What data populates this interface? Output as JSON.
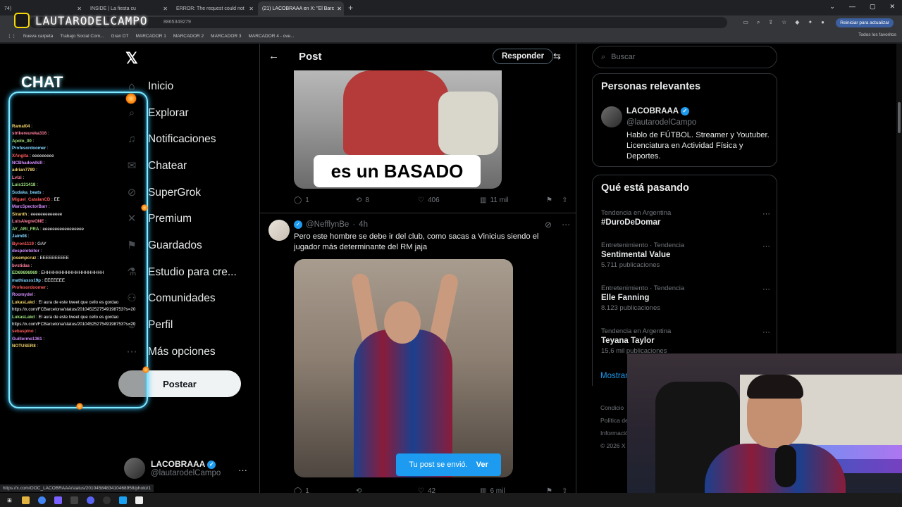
{
  "browser": {
    "tabs": [
      {
        "label": "74) ",
        "active": false
      },
      {
        "label": "INSIDE | La fiesta cu",
        "active": false
      },
      {
        "label": "ERROR: The request could not",
        "active": false
      },
      {
        "label": "(21) LACOBRAAA en X: \"El Barc",
        "active": true
      }
    ],
    "new_tab": "+",
    "url_fragment": "8865349279",
    "update_button": "Reiniciar para actualizar",
    "bookmarks": [
      "Nueva carpeta",
      "Trabajo Social Com...",
      "Gran DT",
      "MARCADOR 1",
      "MARCADOR 2",
      "MARCADOR 3",
      "MARCADOR 4 - ove..."
    ],
    "all_bookmarks": "Todos los favoritos",
    "status_url": "https://x.com/OOC_LACOBRAAA/status/2010458483410468958/photo/1"
  },
  "overlay": {
    "logo_text": "LAUTARODELCAMPO",
    "chat_title": "CHAT",
    "chat_lines": [
      {
        "user": "Ramal04",
        "msg": ""
      },
      {
        "user": "strikereureka316",
        "msg": ""
      },
      {
        "user": "Apolo_00",
        "msg": ""
      },
      {
        "user": "Profesordoomer",
        "msg": ""
      },
      {
        "user": "XAngita",
        "msg": "eeeeeeeee"
      },
      {
        "user": "NCBhadowlkill",
        "msg": ""
      },
      {
        "user": "adrian7789",
        "msg": ""
      },
      {
        "user": "Lvlzi",
        "msg": ""
      },
      {
        "user": "Luis131418",
        "msg": ""
      },
      {
        "user": "Sudaka_beats",
        "msg": ""
      },
      {
        "user": "Miguel_CatalanCD",
        "msg": "EE"
      },
      {
        "user": "MarcSpectorBarr",
        "msg": ""
      },
      {
        "user": "Siranth",
        "msg": "eeeeeeeeeeeee"
      },
      {
        "user": "LuisAlegreONE",
        "msg": ""
      },
      {
        "user": "AY_ARI_FRA",
        "msg": "eeeeeeeeeeeeeeeee"
      },
      {
        "user": "Jaim08",
        "msg": ""
      },
      {
        "user": "Byron1119",
        "msg": "GAY"
      },
      {
        "user": "despeloteitor",
        "msg": ""
      },
      {
        "user": "josempcruz",
        "msg": "EEEEEEEEEE"
      },
      {
        "user": "bvstidas",
        "msg": ""
      },
      {
        "user": "ED69696969",
        "msg": "EHHHHHHHHHHHHHHHHHHH"
      },
      {
        "user": "mathiasss19p",
        "msg": "EEEEEEE"
      },
      {
        "user": "Profesordoomer",
        "msg": ""
      },
      {
        "user": "Roomydel",
        "msg": ""
      },
      {
        "user": "LukasLakd",
        "msg": "El aura de este tweet que cello es gordao"
      },
      {
        "user": "",
        "msg": "https://x.com/FCBarcelona/status/2010452527549198753?s=20"
      },
      {
        "user": "LukasLakd",
        "msg": "El aura de este tweet que cello es gordao"
      },
      {
        "user": "",
        "msg": "https://x.com/FCBarcelona/status/2010452527549198753?s=20"
      },
      {
        "user": "sebaspino",
        "msg": ""
      },
      {
        "user": "Guillermo1361",
        "msg": ""
      },
      {
        "user": "NOTUSER8",
        "msg": ""
      }
    ]
  },
  "nav": {
    "items": [
      {
        "label": "Inicio",
        "icon": "home-icon"
      },
      {
        "label": "Explorar",
        "icon": "search-icon"
      },
      {
        "label": "Notificaciones",
        "icon": "bell-icon"
      },
      {
        "label": "Chatear",
        "icon": "mail-icon"
      },
      {
        "label": "SuperGrok",
        "icon": "grok-icon"
      },
      {
        "label": "Premium",
        "icon": "x-icon"
      },
      {
        "label": "Guardados",
        "icon": "bookmark-icon"
      },
      {
        "label": "Estudio para cre...",
        "icon": "flask-icon"
      },
      {
        "label": "Comunidades",
        "icon": "people-icon"
      },
      {
        "label": "Perfil",
        "icon": "person-icon"
      },
      {
        "label": "Más opciones",
        "icon": "more-icon"
      }
    ],
    "post_button": "Postear",
    "account_name": "LACOBRAAA",
    "account_handle": "@lautarodelCampo",
    "more": "···"
  },
  "main": {
    "title": "Post",
    "reply_button": "Responder",
    "image1_caption": "es un BASADO",
    "post1_stats": {
      "replies": "1",
      "reposts": "8",
      "likes": "406",
      "views": "11 mil"
    },
    "tweet2": {
      "handle": "@NefflynBe",
      "time": "4h",
      "text": "Pero este hombre se debe ir del club, como sacas a Vinicius siendo el jugador más determinante del RM jaja",
      "stats": {
        "replies": "1",
        "reposts": "",
        "likes": "42",
        "views": "6 mil"
      }
    },
    "toast_text": "Tu post se envió.",
    "toast_link": "Ver"
  },
  "right": {
    "search_placeholder": "Buscar",
    "relevant_title": "Personas relevantes",
    "relevant_name": "LACOBRAAA",
    "relevant_handle": "@lautarodelCampo",
    "relevant_bio": "Hablo de FÚTBOL. Streamer y Youtuber. Licenciatura en Actividad Física y Deportes.",
    "trends_title": "Qué está pasando",
    "trends": [
      {
        "cat": "Tendencia en Argentina",
        "name": "#DuroDeDomar",
        "count": ""
      },
      {
        "cat": "Entretenimiento · Tendencia",
        "name": "Sentimental Value",
        "count": "5.711 publicaciones"
      },
      {
        "cat": "Entretenimiento · Tendencia",
        "name": "Elle Fanning",
        "count": "8.123 publicaciones"
      },
      {
        "cat": "Tendencia en Argentina",
        "name": "Teyana Taylor",
        "count": "15,6 mil publicaciones"
      }
    ],
    "show_more": "Mostrar",
    "footer": [
      "Condicio",
      "Política de",
      "Informació",
      "© 2026 X"
    ]
  }
}
